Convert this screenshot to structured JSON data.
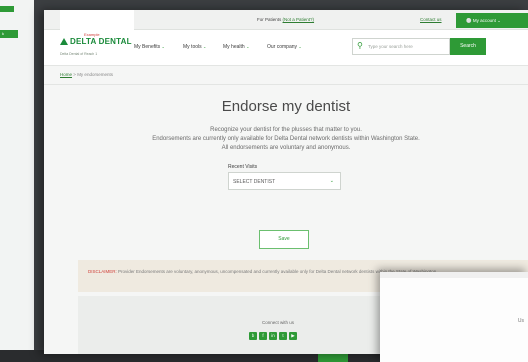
{
  "background": {
    "left_window_chip": "k"
  },
  "topbar": {
    "patients_text": "For Patients",
    "patients_link": "(Not a Patient?)",
    "contact_link": "Contact us",
    "account_label": "My account"
  },
  "header": {
    "logo_small": "Example",
    "logo_brand": "DELTA DENTAL",
    "logo_sub": "Delta Dental of Reach 1",
    "nav": [
      "My Benefits",
      "My tools",
      "My health",
      "Our company"
    ],
    "search_placeholder": "Type your search here",
    "search_button": "Search"
  },
  "breadcrumb": {
    "home": "Home",
    "separator": ">",
    "current": "My endorsements"
  },
  "main": {
    "title": "Endorse my dentist",
    "description": [
      "Recognize your dentist for the plusses that matter to you.",
      "Endorsements are currently only available for Delta Dental network dentists within Washington State.",
      "All endorsements are voluntary and anonymous."
    ],
    "recent_visits_label": "Recent Visits",
    "select_value": "SELECT DENTIST",
    "save_label": "Save"
  },
  "disclaimer": {
    "label": "DISCLAIMER:",
    "text": "Provider Endorsements are voluntary, anonymous, uncompensated and currently available only for Delta Dental network dentists within the State of Washington."
  },
  "footer": {
    "connect": "Connect with us",
    "social_icons": [
      "blog-icon",
      "facebook-icon",
      "linkedin-icon",
      "twitter-icon",
      "youtube-icon"
    ]
  },
  "overlay": {
    "text": "Us"
  },
  "colors": {
    "brand_green": "#2e9a36",
    "accent_red": "#d0413b"
  }
}
